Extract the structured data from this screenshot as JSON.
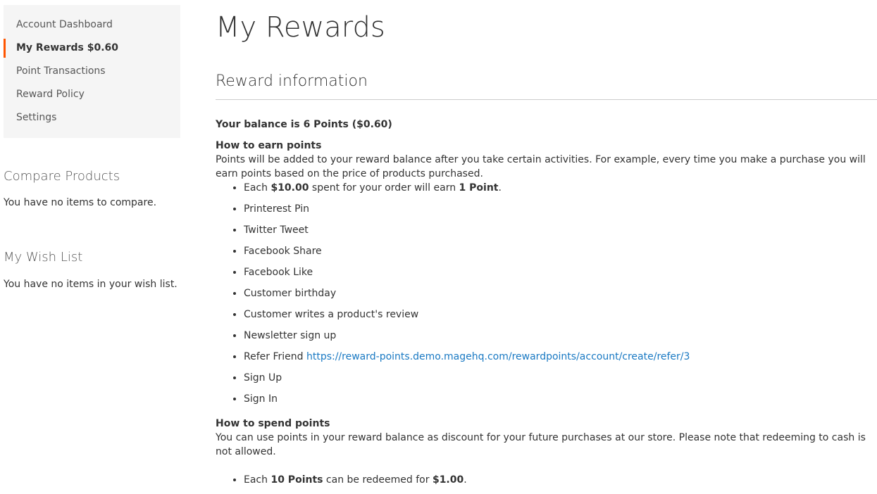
{
  "sidebar": {
    "items": [
      {
        "label": "Account Dashboard"
      },
      {
        "label": "My Rewards $0.60"
      },
      {
        "label": "Point Transactions"
      },
      {
        "label": "Reward Policy"
      },
      {
        "label": "Settings"
      }
    ],
    "compare": {
      "title": "Compare Products",
      "empty": "You have no items to compare."
    },
    "wishlist": {
      "title": "My Wish List",
      "empty": "You have no items in your wish list."
    }
  },
  "main": {
    "page_title": "My Rewards",
    "section_title": "Reward information",
    "balance_text": "Your balance is 6 Points ($0.60)",
    "earn": {
      "heading": "How to earn points",
      "description": "Points will be added to your reward balance after you take certain activities. For example, every time you make a purchase you will earn points based on the price of products purchased.",
      "first_rule": {
        "pre": "Each ",
        "amount": "$10.00",
        "mid": " spent for your order will earn ",
        "points": "1 Point",
        "post": "."
      },
      "rules": [
        "Printerest Pin",
        "Twitter Tweet",
        "Facebook Share",
        "Facebook Like",
        "Customer birthday",
        "Customer writes a product's review",
        "Newsletter sign up"
      ],
      "refer": {
        "label": "Refer Friend ",
        "link": "https://reward-points.demo.magehq.com/rewardpoints/account/create/refer/3"
      },
      "after_refer": [
        "Sign Up",
        "Sign In"
      ]
    },
    "spend": {
      "heading": "How to spend points",
      "description": "You can use points in your reward balance as discount for your future purchases at our store. Please note that redeeming to cash is not allowed.",
      "rule": {
        "pre": "Each ",
        "points": "10 Points",
        "mid": " can be redeemed for ",
        "amount": "$1.00",
        "post": "."
      }
    }
  },
  "colors": {
    "accent": "#ff5501",
    "link": "#1979c3",
    "nav_bg": "#f5f5f5"
  }
}
